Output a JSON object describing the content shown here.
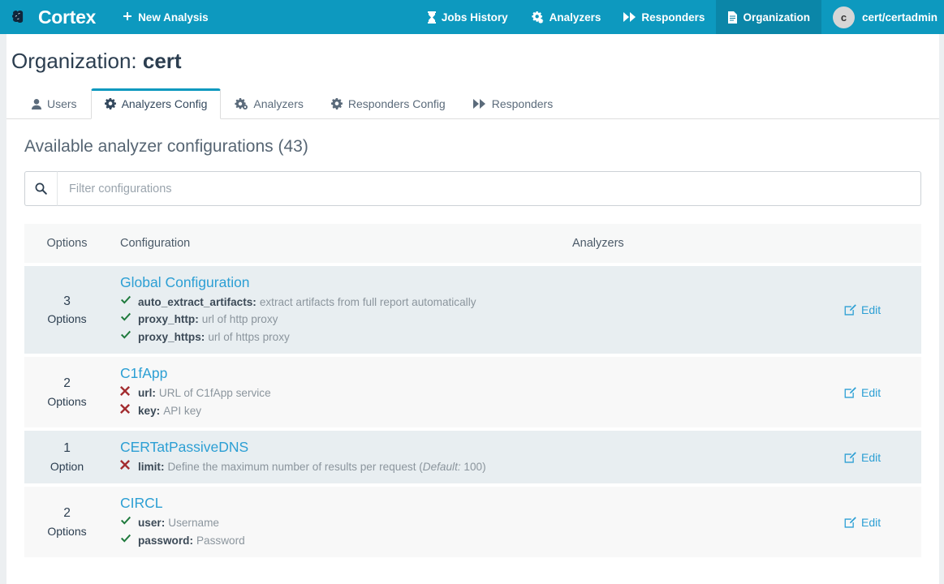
{
  "navbar": {
    "brand": "Cortex",
    "brand_icon": "brain-icon",
    "left_items": [
      {
        "label": "New Analysis",
        "icon": "plus-icon"
      }
    ],
    "right_items": [
      {
        "label": "Jobs History",
        "icon": "hourglass-icon",
        "active": false
      },
      {
        "label": "Analyzers",
        "icon": "gears-icon",
        "active": false
      },
      {
        "label": "Responders",
        "icon": "forward-icon",
        "active": false
      },
      {
        "label": "Organization",
        "icon": "file-text-icon",
        "active": true
      }
    ],
    "user": {
      "initial": "c",
      "label": "cert/certadmin"
    },
    "background": "#0d99bf",
    "active_background": "#0b86a8"
  },
  "page": {
    "title_prefix": "Organization:",
    "title_org": "cert"
  },
  "tabs": [
    {
      "label": "Users",
      "icon": "user-icon",
      "active": false
    },
    {
      "label": "Analyzers Config",
      "icon": "gear-icon",
      "active": true
    },
    {
      "label": "Analyzers",
      "icon": "gears-icon",
      "active": false
    },
    {
      "label": "Responders Config",
      "icon": "gear-icon",
      "active": false
    },
    {
      "label": "Responders",
      "icon": "forward-icon",
      "active": false
    }
  ],
  "section": {
    "heading": "Available analyzer configurations (43)"
  },
  "filter": {
    "icon": "search-icon",
    "placeholder": "Filter configurations",
    "value": ""
  },
  "table": {
    "headers": {
      "options": "Options",
      "configuration": "Configuration",
      "analyzers": "Analyzers"
    },
    "edit_label": "Edit",
    "edit_icon": "pencil-square-icon",
    "rows": [
      {
        "count": "3",
        "count_label": "Options",
        "name": "Global Configuration",
        "options": [
          {
            "status": "check",
            "name": "auto_extract_artifacts:",
            "desc": "extract artifacts from full report automatically"
          },
          {
            "status": "check",
            "name": "proxy_http:",
            "desc": "url of http proxy"
          },
          {
            "status": "check",
            "name": "proxy_https:",
            "desc": "url of https proxy"
          }
        ]
      },
      {
        "count": "2",
        "count_label": "Options",
        "name": "C1fApp",
        "options": [
          {
            "status": "cross",
            "name": "url:",
            "desc": "URL of C1fApp service"
          },
          {
            "status": "cross",
            "name": "key:",
            "desc": "API key"
          }
        ]
      },
      {
        "count": "1",
        "count_label": "Option",
        "name": "CERTatPassiveDNS",
        "options": [
          {
            "status": "cross",
            "name": "limit:",
            "desc_pre": "Define the maximum number of results per request (",
            "desc_em": "Default:",
            "desc_post": " 100)"
          }
        ]
      },
      {
        "count": "2",
        "count_label": "Options",
        "name": "CIRCL",
        "options": [
          {
            "status": "check",
            "name": "user:",
            "desc": "Username"
          },
          {
            "status": "check",
            "name": "password:",
            "desc": "Password"
          }
        ]
      }
    ]
  },
  "colors": {
    "brand_blue": "#0d99bf",
    "link_blue": "#2c9fd4",
    "check_green": "#1f7a3d",
    "cross_red": "#a32d30",
    "page_bg": "#eceff1",
    "row_odd": "#e8eef1",
    "row_even": "#f8f8f8"
  }
}
